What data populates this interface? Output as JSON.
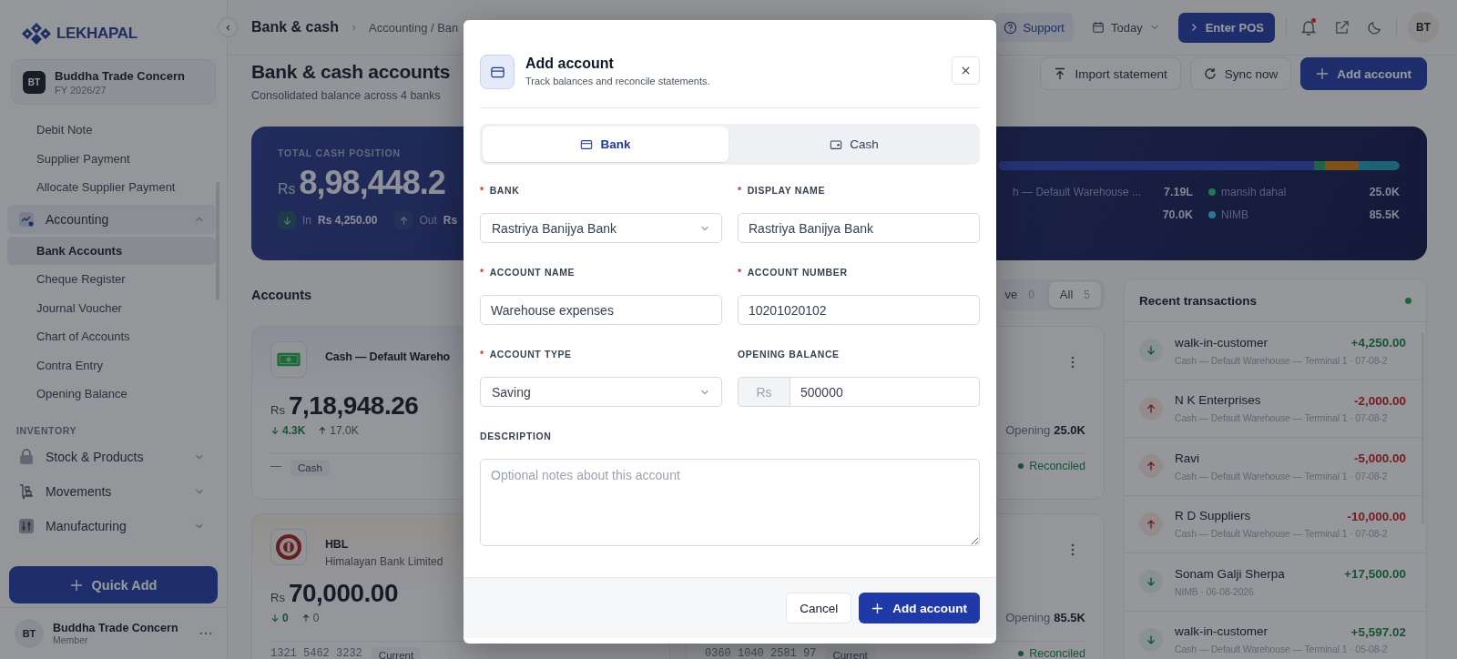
{
  "sidebar": {
    "brand": "LEKHAPAL",
    "company": {
      "initials": "BT",
      "name": "Buddha Trade Concern",
      "period": "FY 2026/27"
    },
    "nav": [
      {
        "kind": "link",
        "label": "Debit Note",
        "selected": false
      },
      {
        "kind": "link",
        "label": "Supplier Payment",
        "selected": false
      },
      {
        "kind": "link",
        "label": "Allocate Supplier Payment",
        "selected": false
      },
      {
        "kind": "group",
        "label": "Accounting",
        "expanded": true,
        "children": [
          {
            "label": "Bank Accounts",
            "selected": true
          },
          {
            "label": "Cheque Register",
            "selected": false
          },
          {
            "label": "Journal Voucher",
            "selected": false
          },
          {
            "label": "Chart of Accounts",
            "selected": false
          },
          {
            "label": "Contra Entry",
            "selected": false
          },
          {
            "label": "Opening Balance",
            "selected": false
          }
        ]
      },
      {
        "kind": "section",
        "label": "INVENTORY"
      },
      {
        "kind": "group",
        "label": "Stock & Products",
        "expanded": false
      },
      {
        "kind": "group",
        "label": "Movements",
        "expanded": false
      },
      {
        "kind": "group",
        "label": "Manufacturing",
        "expanded": false
      }
    ],
    "quick_add": "Quick Add",
    "user": {
      "initials": "BT",
      "name": "Buddha Trade Concern",
      "role": "Member"
    }
  },
  "topbar": {
    "title": "Bank & cash",
    "breadcrumb": "Accounting / Ban",
    "support": "Support",
    "date_filter": "Today",
    "pos_button": "Enter POS",
    "notifications_unread": true,
    "avatar": "BT"
  },
  "header": {
    "title": "Bank & cash accounts",
    "subtitle": "Consolidated balance across 4 banks",
    "actions": [
      {
        "label": "Import statement",
        "kind": "import"
      },
      {
        "label": "Sync now",
        "kind": "sync"
      },
      {
        "label": "Add account",
        "kind": "primary"
      }
    ]
  },
  "hero": {
    "label": "TOTAL CASH POSITION",
    "currency": "Rs",
    "amount": "8,98,448.2",
    "flows": [
      {
        "incoming": true,
        "label": "In",
        "value": "Rs 4,250.00"
      },
      {
        "incoming": false,
        "label": "Out",
        "value": "Rs"
      }
    ],
    "legend": [
      {
        "label": "h — Default Warehouse ...",
        "value": "7.19L"
      },
      {
        "label": "mansih dahal",
        "value": "25.0K",
        "color": "#1d7a50"
      },
      {
        "value": "70.0K"
      },
      {
        "label": "NIMB",
        "value": "85.5K",
        "color": "#2b7595"
      }
    ]
  },
  "accounts": {
    "title": "Accounts",
    "filters": [
      {
        "label": "ve",
        "count": "0",
        "selected": false
      },
      {
        "label": "All",
        "count": "5",
        "selected": true
      }
    ],
    "cards": [
      {
        "kind": "cash",
        "name": "Cash — Default Wareho",
        "currency": "Rs",
        "balance": "7,18,948.26",
        "inflow": "4.3K",
        "outflow": "17.0K",
        "footer_note": "—",
        "tag": "Cash"
      },
      {
        "opening_label": "Opening",
        "opening": "25.0K",
        "status": "Reconciled"
      },
      {
        "kind": "bank",
        "name": "HBL",
        "subtitle": "Himalayan Bank Limited",
        "currency": "Rs",
        "balance": "70,000.00",
        "inflow": "0",
        "outflow": "0",
        "number": "1321 5462 3232",
        "tag": "Current"
      },
      {
        "opening_label": "Opening",
        "opening": "85.5K",
        "number": "0360 1040 2581 97",
        "tag": "Current",
        "status": "Reconciled"
      }
    ]
  },
  "transactions": {
    "title": "Recent transactions",
    "live": true,
    "items": [
      {
        "incoming": true,
        "name": "walk-in-customer",
        "detail": "Cash — Default Warehouse — Terminal 1 · 07-08-2",
        "amount": "+4,250.00"
      },
      {
        "incoming": false,
        "name": "N K Enterprises",
        "detail": "Cash — Default Warehouse — Terminal 1 · 07-08-2",
        "amount": "-2,000.00"
      },
      {
        "incoming": false,
        "name": "Ravi",
        "detail": "Cash — Default Warehouse — Terminal 1 · 07-08-2",
        "amount": "-5,000.00"
      },
      {
        "incoming": false,
        "name": "R D Suppliers",
        "detail": "Cash — Default Warehouse — Terminal 1 · 07-08-2",
        "amount": "-10,000.00"
      },
      {
        "incoming": true,
        "name": "Sonam Galji Sherpa",
        "detail": "NIMB · 06-08-2026",
        "amount": "+17,500.00"
      },
      {
        "incoming": true,
        "name": "walk-in-customer",
        "detail": "Cash — Default Warehouse — Terminal 1 · 05-08-2",
        "amount": "+5,597.02"
      }
    ]
  },
  "modal": {
    "title": "Add account",
    "subtitle": "Track balances and reconcile statements.",
    "tabs": [
      {
        "label": "Bank",
        "kind": "bank",
        "selected": true
      },
      {
        "label": "Cash",
        "kind": "cash",
        "selected": false
      }
    ],
    "fields": [
      {
        "label": "BANK",
        "marker": "*",
        "kind": "select",
        "value": "Rastriya Banijya Bank"
      },
      {
        "label": "DISPLAY NAME",
        "marker": "*",
        "kind": "text",
        "value": "Rastriya Banijya Bank"
      },
      {
        "label": "ACCOUNT NAME",
        "marker": "*",
        "kind": "text",
        "value": "Warehouse expenses"
      },
      {
        "label": "ACCOUNT NUMBER",
        "marker": "*",
        "kind": "text",
        "value": "10201020102"
      },
      {
        "label": "ACCOUNT TYPE",
        "marker": "*",
        "kind": "select",
        "value": "Saving"
      },
      {
        "label": "OPENING BALANCE",
        "kind": "money",
        "prefix": "Rs",
        "value": "500000"
      },
      {
        "label": "DESCRIPTION",
        "kind": "textarea",
        "placeholder": "Optional notes about this account"
      }
    ],
    "cancel": "Cancel",
    "submit": "Add account"
  }
}
